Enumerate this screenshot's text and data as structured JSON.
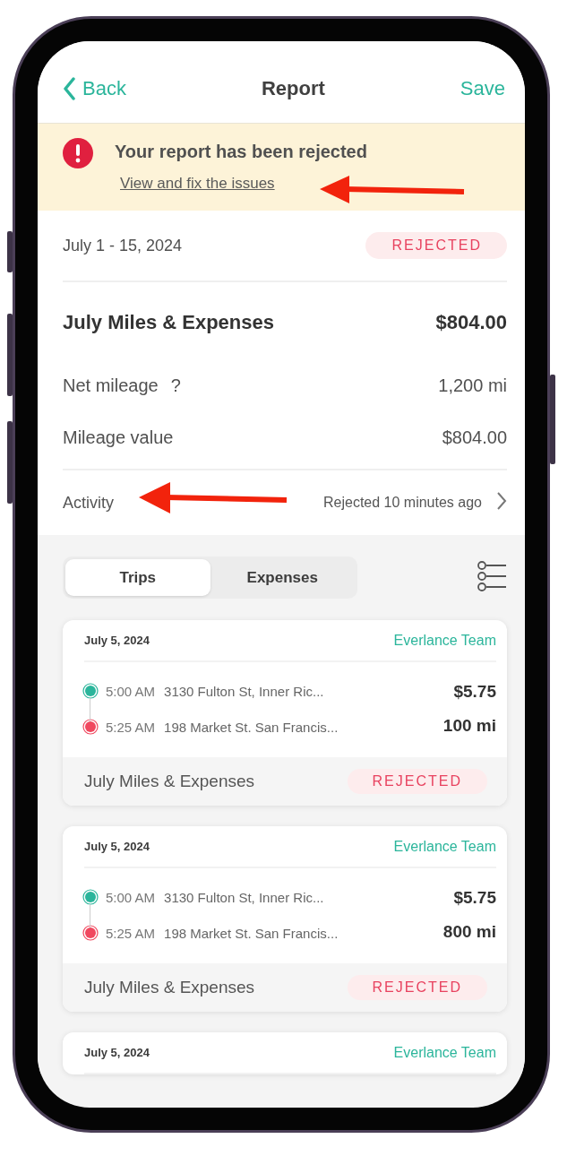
{
  "nav": {
    "back": "Back",
    "title": "Report",
    "save": "Save"
  },
  "banner": {
    "message": "Your report has been rejected",
    "link": "View and fix the issues"
  },
  "report": {
    "period": "July 1 - 15, 2024",
    "status": "REJECTED",
    "name": "July Miles & Expenses",
    "total": "$804.00",
    "rows": [
      {
        "label": "Net mileage",
        "help": "?",
        "value": "1,200 mi"
      },
      {
        "label": "Mileage value",
        "value": "$804.00"
      }
    ],
    "activity": {
      "label": "Activity",
      "value": "Rejected 10 minutes ago"
    }
  },
  "tabs": [
    {
      "label": "Trips",
      "selected": true
    },
    {
      "label": "Expenses",
      "selected": false
    }
  ],
  "trips": [
    {
      "date": "July 5, 2024",
      "team": "Everlance Team",
      "stops": [
        {
          "time": "5:00 AM",
          "address": "3130 Fulton St, Inner Ric..."
        },
        {
          "time": "5:25 AM",
          "address": "198 Market St. San Francis..."
        }
      ],
      "amount": "$5.75",
      "distance": "100 mi",
      "report": "July Miles & Expenses",
      "status": "REJECTED"
    },
    {
      "date": "July 5, 2024",
      "team": "Everlance Team",
      "stops": [
        {
          "time": "5:00 AM",
          "address": "3130 Fulton St, Inner Ric..."
        },
        {
          "time": "5:25 AM",
          "address": "198 Market St. San Francis..."
        }
      ],
      "amount": "$5.75",
      "distance": "800 mi",
      "report": "July Miles & Expenses",
      "status": "REJECTED"
    },
    {
      "date": "July 5, 2024",
      "team": "Everlance Team"
    }
  ]
}
